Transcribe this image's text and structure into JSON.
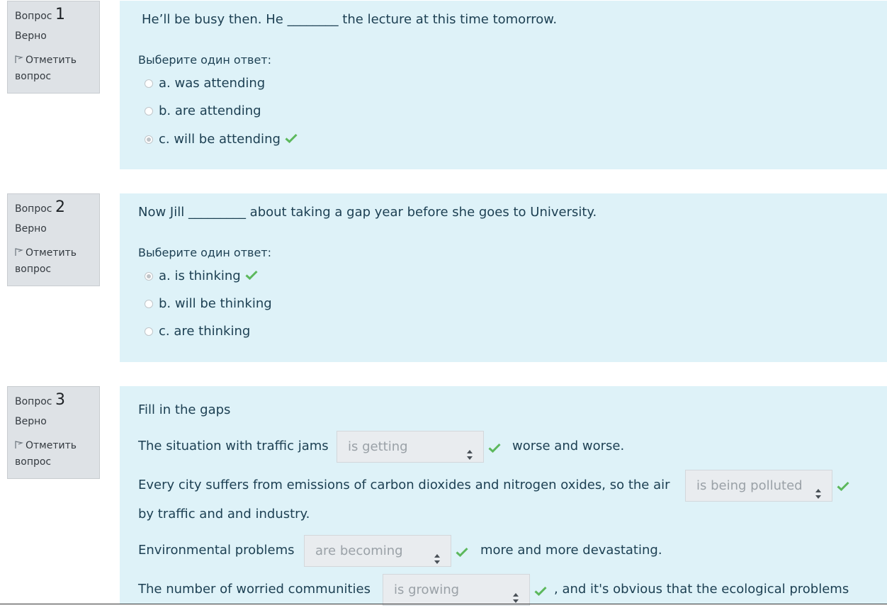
{
  "questions": [
    {
      "label": "Вопрос",
      "number": "1",
      "state": "Верно",
      "flag_line1": "Отметить",
      "flag_line2": "вопрос",
      "text": "He’ll be busy then. He ________ the lecture at this time tomorrow.",
      "prompt": "Выберите один ответ:",
      "options": [
        "a. was attending",
        "b. are attending",
        "c. will be attending"
      ],
      "selected": 2
    },
    {
      "label": "Вопрос",
      "number": "2",
      "state": "Верно",
      "flag_line1": "Отметить",
      "flag_line2": "вопрос",
      "text": "Now Jill _________ about taking a gap year before she goes to University.",
      "prompt": "Выберите один ответ:",
      "options": [
        "a. is thinking",
        "b. will be thinking",
        "c. are thinking"
      ],
      "selected": 0
    },
    {
      "label": "Вопрос",
      "number": "3",
      "state": "Верно",
      "flag_line1": "Отметить",
      "flag_line2": "вопрос",
      "title": "Fill in the gaps",
      "s1_before": "The situation with traffic jams",
      "s1_select": "is getting",
      "s1_after": "worse and worse.",
      "s2_before": "Every city suffers from emissions of carbon dioxides and nitrogen oxides, so the air",
      "s2_select": "is being polluted",
      "s2_after": "by traffic and and industry.",
      "s3_before": "Environmental problems",
      "s3_select": "are becoming",
      "s3_after": "more and more devastating.",
      "s4_before": "The number of worried communities",
      "s4_select": "is growing",
      "s4_after": ", and it's obvious that the ecological problems"
    }
  ],
  "colors": {
    "correct": "#5cb85c",
    "panel": "#def2f8",
    "info": "#dee2e6"
  }
}
